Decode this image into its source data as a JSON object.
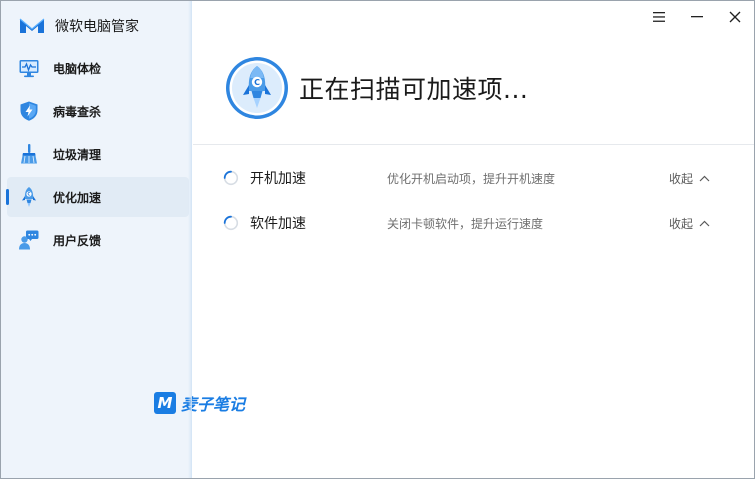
{
  "app": {
    "name": "微软电脑管家",
    "accent": "#1a73d9"
  },
  "sidebar": {
    "items": [
      {
        "label": "电脑体检",
        "icon": "monitor-heartbeat-icon",
        "active": false
      },
      {
        "label": "病毒查杀",
        "icon": "shield-lightning-icon",
        "active": false
      },
      {
        "label": "垃圾清理",
        "icon": "broom-icon",
        "active": false
      },
      {
        "label": "优化加速",
        "icon": "rocket-icon",
        "active": true
      },
      {
        "label": "用户反馈",
        "icon": "user-feedback-icon",
        "active": false
      }
    ]
  },
  "window_controls": {
    "menu_icon": "hamburger-menu-icon",
    "minimize_icon": "minimize-icon",
    "close_icon": "close-icon"
  },
  "main": {
    "status_title": "正在扫描可加速项...",
    "tasks": [
      {
        "name": "开机加速",
        "description": "优化开机启动项，提升开机速度",
        "action": "收起"
      },
      {
        "name": "软件加速",
        "description": "关闭卡顿软件，提升运行速度",
        "action": "收起"
      }
    ]
  },
  "watermark": {
    "mark": "M",
    "text": "麦子笔记"
  }
}
